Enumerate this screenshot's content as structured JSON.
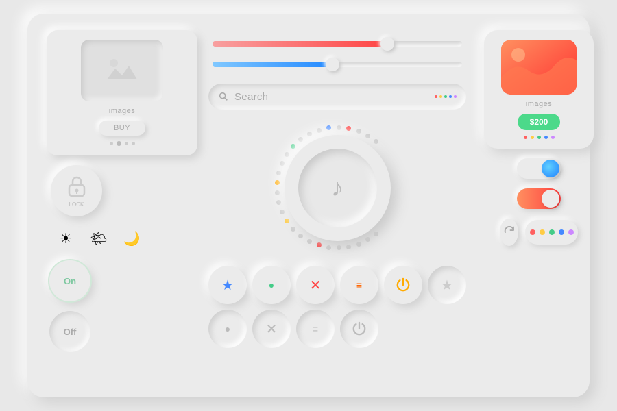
{
  "image_card": {
    "label": "images",
    "buy_label": "BUY"
  },
  "search": {
    "placeholder": "Search"
  },
  "app_card": {
    "label": "images",
    "price": "$200"
  },
  "toggles": {
    "blue_label": "toggle-blue",
    "orange_label": "toggle-orange"
  },
  "on_btn": "On",
  "off_btn": "Off",
  "knob_icon": "♪",
  "lock_label": "LOCK",
  "weather": {
    "sun": "☀",
    "cloud": "🌤",
    "moon": "🌙"
  },
  "buttons": {
    "star_active_color": "#4488ff",
    "dot_active_color": "#44cc88",
    "x_active_color": "#ff4444",
    "eq_active_color": "#ff6600",
    "power_active_color": "#ffaa00"
  },
  "indicator_dots": [
    "#ff6060",
    "#ffcc00",
    "#44cc88",
    "#4488ff",
    "#cc88ff"
  ]
}
